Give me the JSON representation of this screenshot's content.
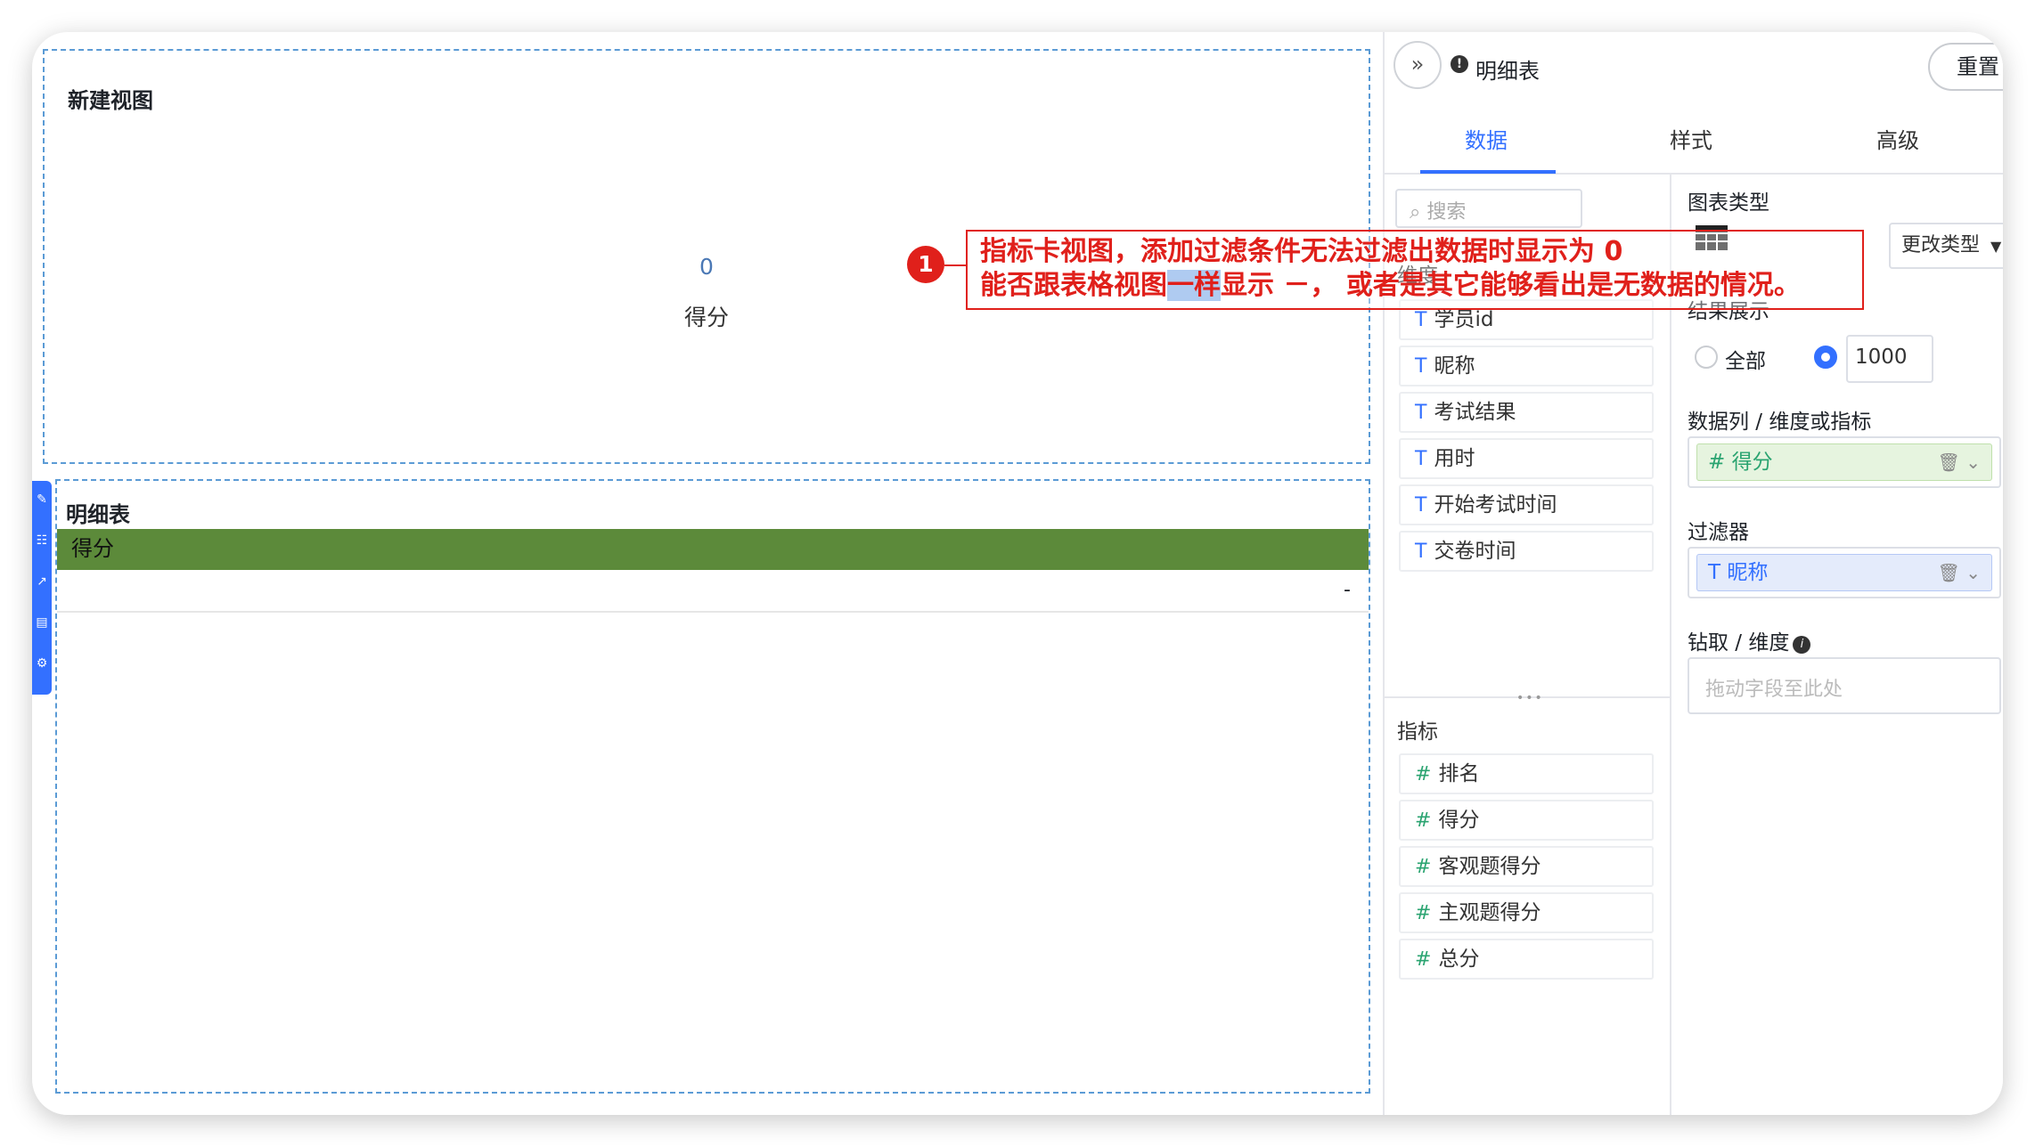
{
  "canvas": {
    "view1": {
      "title": "新建视图",
      "value": "0",
      "label": "得分"
    },
    "view2": {
      "title": "明细表",
      "column_header": "得分",
      "cell_value": "-"
    }
  },
  "panel": {
    "title": "明细表",
    "reset_label": "重置",
    "tabs": [
      "数据",
      "样式",
      "高级"
    ],
    "search_placeholder": "搜索",
    "dimensions_label": "维度",
    "dimensions": [
      "学员id",
      "昵称",
      "考试结果",
      "用时",
      "开始考试时间",
      "交卷时间"
    ],
    "indicators_label": "指标",
    "indicators": [
      "排名",
      "得分",
      "客观题得分",
      "主观题得分",
      "总分"
    ],
    "chart_type_label": "图表类型",
    "change_type_label": "更改类型",
    "result_label": "结果展示",
    "result_all": "全部",
    "result_limit": "1000",
    "columns_label": "数据列 / 维度或指标",
    "columns_chip": "得分",
    "filter_label": "过滤器",
    "filter_chip": "昵称",
    "drill_label": "钻取 / 维度",
    "drill_placeholder": "拖动字段至此处"
  },
  "annotation": {
    "number": "1",
    "line1": "指标卡视图，添加过滤条件无法过滤出数据时显示为 0",
    "line2_a": "能否跟表格视图",
    "line2_hl": "一样",
    "line2_b": "显示 －， 或者是其它能够看出是无数据的情况。"
  },
  "colors": {
    "accent": "#3370ff",
    "table_header": "#5c8a3a",
    "annotation": "#e0201b",
    "dashed_border": "#5b9bd5"
  }
}
